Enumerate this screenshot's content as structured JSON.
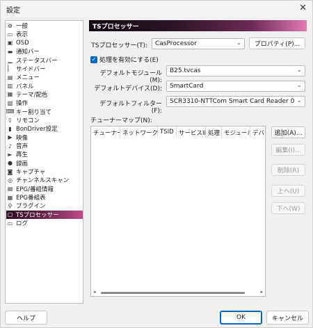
{
  "window": {
    "title": "設定",
    "close_glyph": "✕"
  },
  "sidebar": {
    "items": [
      {
        "label": "一般",
        "icon": "gear-icon",
        "glyph": "⚙"
      },
      {
        "label": "表示",
        "icon": "display-icon",
        "glyph": "▭"
      },
      {
        "label": "OSD",
        "icon": "osd-icon",
        "glyph": "▣"
      },
      {
        "label": "通知バー",
        "icon": "notify-bar-icon",
        "glyph": "▬"
      },
      {
        "label": "ステータスバー",
        "icon": "status-bar-icon",
        "glyph": "▁"
      },
      {
        "label": "サイドバー",
        "icon": "side-bar-icon",
        "glyph": "▏"
      },
      {
        "label": "メニュー",
        "icon": "menu-icon",
        "glyph": "▤"
      },
      {
        "label": "パネル",
        "icon": "panel-icon",
        "glyph": "▥"
      },
      {
        "label": "テーマ/配色",
        "icon": "theme-icon",
        "glyph": "▦"
      },
      {
        "label": "操作",
        "icon": "operation-icon",
        "glyph": "▧"
      },
      {
        "label": "キー割り当て",
        "icon": "keyboard-icon",
        "glyph": "⌨"
      },
      {
        "label": "リモコン",
        "icon": "remote-icon",
        "glyph": "▯"
      },
      {
        "label": "BonDriver設定",
        "icon": "bondriver-icon",
        "glyph": "▮"
      },
      {
        "label": "映像",
        "icon": "video-icon",
        "glyph": "▶"
      },
      {
        "label": "音声",
        "icon": "audio-icon",
        "glyph": "♪"
      },
      {
        "label": "再生",
        "icon": "play-icon",
        "glyph": "►"
      },
      {
        "label": "録画",
        "icon": "record-icon",
        "glyph": "●"
      },
      {
        "label": "キャプチャ",
        "icon": "capture-icon",
        "glyph": "◙"
      },
      {
        "label": "チャンネルスキャン",
        "icon": "channel-scan-icon",
        "glyph": "◎"
      },
      {
        "label": "EPG/番組情報",
        "icon": "epg-info-icon",
        "glyph": "▤"
      },
      {
        "label": "EPG番組表",
        "icon": "epg-table-icon",
        "glyph": "▦"
      },
      {
        "label": "プラグイン",
        "icon": "plugin-icon",
        "glyph": "⚲"
      },
      {
        "label": "TSプロセッサー",
        "icon": "ts-processor-icon",
        "glyph": "▢",
        "selected": true
      },
      {
        "label": "ログ",
        "icon": "log-icon",
        "glyph": "▭"
      }
    ]
  },
  "main": {
    "header": "TSプロセッサー",
    "ts_processor_label": "TSプロセッサー(T):",
    "ts_processor_value": "CasProcessor",
    "properties_button": "プロパティ(P)...",
    "enable_checkbox_label": "処理を有効にする(E)",
    "enable_checked": true,
    "check_glyph": "✓",
    "dropdown_glyph": "⌄",
    "default_module_label": "デフォルトモジュール(M):",
    "default_module_value": "B25.tvcas",
    "default_device_label": "デフォルトデバイス(D):",
    "default_device_value": "SmartCard",
    "default_filter_label": "デフォルトフィルター(F):",
    "default_filter_value": "SCR3310-NTTCom Smart Card Reader 0",
    "tuner_map_label": "チューナーマップ(N):",
    "table_columns": [
      "チューナー",
      "ネットワークID",
      "TSID",
      "サービスID",
      "処理",
      "モジュール",
      "デバイ"
    ],
    "scroll_left_glyph": "◂",
    "scroll_right_glyph": "▸",
    "side_buttons": {
      "add": "追加(A)...",
      "edit": "編集(I)...",
      "delete": "削除(R)",
      "up": "上へ(U)",
      "down": "下へ(W)"
    }
  },
  "footer": {
    "help": "ヘルプ",
    "ok": "OK",
    "cancel": "キャンセル"
  },
  "colors": {
    "accent": "#0067c0",
    "header_start": "#120810",
    "header_end": "#e37ab2"
  }
}
